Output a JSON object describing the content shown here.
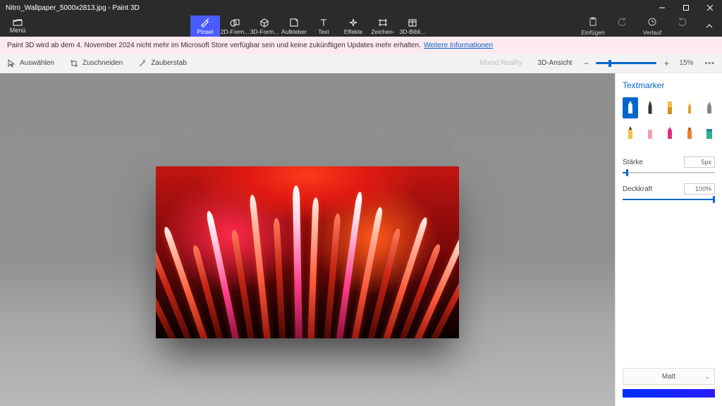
{
  "window": {
    "title": "Nitro_Wallpaper_5000x2813.jpg - Paint 3D"
  },
  "ribbon": {
    "menu": "Menü",
    "tools": [
      {
        "label": "Pinsel",
        "active": true
      },
      {
        "label": "2D-Form..."
      },
      {
        "label": "3D-Form..."
      },
      {
        "label": "Aufkleber"
      },
      {
        "label": "Text"
      },
      {
        "label": "Effekte"
      },
      {
        "label": "Zeichen-"
      },
      {
        "label": "3D-Bibli..."
      }
    ],
    "right": {
      "paste": "Einfügen",
      "history": "Verlauf"
    }
  },
  "notice": {
    "text": "Paint 3D wird ab dem 4. November 2024 nicht mehr im Microsoft Store verfügbar sein und keine zukünftigen Updates mehr erhalten.",
    "link": "Weitere Informationen"
  },
  "subbar": {
    "select": "Auswählen",
    "crop": "Zuschneiden",
    "magic": "Zauberstab",
    "mixed": "Mixed Reality",
    "view3d": "3D-Ansicht",
    "zoom_pct": "15%"
  },
  "panel": {
    "title": "Textmarker",
    "thickness_label": "Stärke",
    "thickness_value": "5px",
    "thickness_pct": 4,
    "opacity_label": "Deckkraft",
    "opacity_value": "100%",
    "opacity_pct": 100,
    "material": "Matt"
  }
}
